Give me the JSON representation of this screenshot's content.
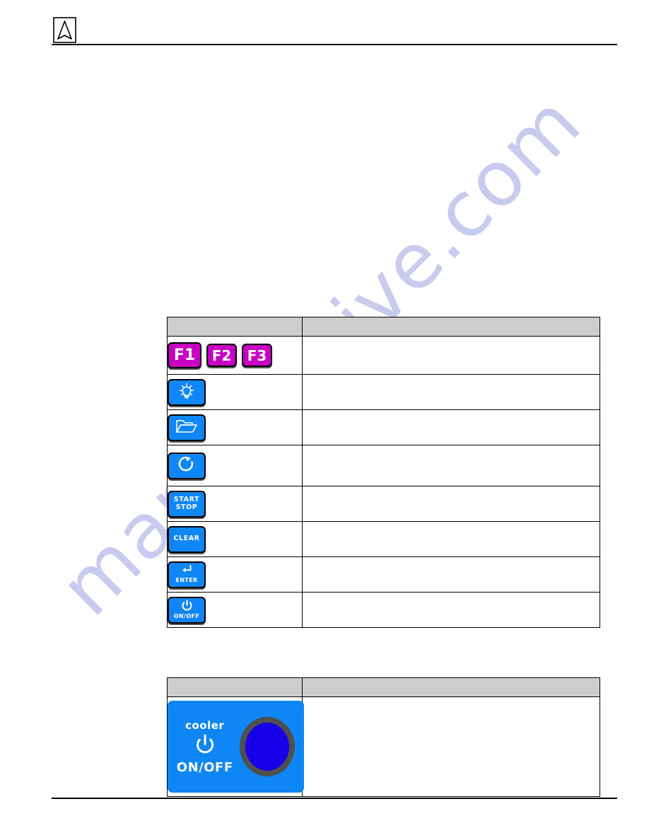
{
  "document": {
    "background_color": "#ffffff",
    "rule_color": "#000000"
  },
  "header": {
    "logo_name": "arrow-in-square-logo",
    "logo_alt": "A"
  },
  "watermark": {
    "text": "manualshive.com",
    "color": "#c9cbee"
  },
  "colors": {
    "function_key": "#c800c3",
    "membrane_key": "#0f86f5",
    "table_header": "#cdcdcd",
    "knob_blue": "#1800e8",
    "knob_ring": "#4f4f4f"
  },
  "keypad_table": {
    "name": "keypad-key-reference-table",
    "headers": [
      "",
      ""
    ],
    "rows": [
      {
        "row_name": "function-keys-row",
        "keys": [
          {
            "icon": "f1-key",
            "label": "F1",
            "style": "magenta"
          },
          {
            "icon": "f2-key",
            "label": "F2",
            "style": "magenta"
          },
          {
            "icon": "f3-key",
            "label": "F3",
            "style": "magenta"
          }
        ],
        "description": ""
      },
      {
        "row_name": "light-key-row",
        "keys": [
          {
            "icon": "light-bulb-icon",
            "label": "",
            "style": "blue"
          }
        ],
        "description": ""
      },
      {
        "row_name": "open-folder-key-row",
        "keys": [
          {
            "icon": "open-folder-icon",
            "label": "",
            "style": "blue"
          }
        ],
        "description": ""
      },
      {
        "row_name": "refresh-key-row",
        "keys": [
          {
            "icon": "circular-arrow-refresh-icon",
            "label": "",
            "style": "blue"
          }
        ],
        "description": ""
      },
      {
        "row_name": "start-stop-key-row",
        "keys": [
          {
            "icon": "start-stop-key",
            "label_line1": "START",
            "label_line2": "STOP",
            "style": "blue"
          }
        ],
        "description": ""
      },
      {
        "row_name": "clear-key-row",
        "keys": [
          {
            "icon": "clear-key",
            "label": "CLEAR",
            "style": "blue"
          }
        ],
        "description": ""
      },
      {
        "row_name": "enter-key-row",
        "keys": [
          {
            "icon": "enter-return-arrow-icon",
            "label": "ENTER",
            "style": "blue"
          }
        ],
        "description": ""
      },
      {
        "row_name": "on-off-key-row",
        "keys": [
          {
            "icon": "power-icon",
            "label": "ON/OFF",
            "style": "blue"
          }
        ],
        "description": ""
      }
    ]
  },
  "cooler_table": {
    "name": "cooler-control-reference-table",
    "headers": [
      "",
      ""
    ],
    "row": {
      "row_name": "cooler-on-off-row",
      "panel": {
        "name": "cooler-on-off-panel",
        "title": "cooler",
        "power_icon": "power-icon",
        "label": "ON/OFF",
        "knob_name": "cooler-round-button"
      },
      "description": ""
    }
  }
}
